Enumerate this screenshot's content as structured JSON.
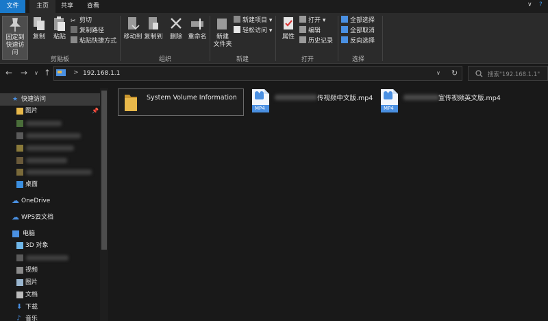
{
  "tabs": {
    "file": "文件",
    "home": "主页",
    "share": "共享",
    "view": "查看"
  },
  "window_controls": {
    "expand": "∨",
    "help": "?"
  },
  "ribbon": {
    "pin_label_line1": "固定到",
    "pin_label_line2": "快速访问",
    "copy": "复制",
    "paste": "粘贴",
    "cut": "剪切",
    "copy_path": "复制路径",
    "paste_shortcut": "粘贴快捷方式",
    "clipboard_group": "剪贴板",
    "move_to": "移动到",
    "copy_to": "复制到",
    "delete": "删除",
    "rename": "重命名",
    "organize_group": "组织",
    "new_folder_line1": "新建",
    "new_folder_line2": "文件夹",
    "new_item": "新建项目",
    "easy_access": "轻松访问",
    "new_group": "新建",
    "properties": "属性",
    "open": "打开",
    "edit": "编辑",
    "history": "历史记录",
    "open_group": "打开",
    "select_all": "全部选择",
    "select_none": "全部取消",
    "invert_selection": "反向选择",
    "select_group": "选择"
  },
  "address": {
    "path": "192.168.1.1",
    "separator": ">"
  },
  "search": {
    "placeholder": "搜索\"192.168.1.1\""
  },
  "nav": {
    "quick_access": "快速访问",
    "pictures_pinned": "图片",
    "desktop": "桌面",
    "onedrive": "OneDrive",
    "wps": "WPS云文档",
    "this_pc": "电脑",
    "objects3d": "3D 对象",
    "videos": "视频",
    "pictures": "图片",
    "documents": "文档",
    "downloads": "下载",
    "music": "音乐"
  },
  "files": [
    {
      "name": "System Volume Information",
      "type": "folder"
    },
    {
      "name_visible": "传视频中文版.mp4",
      "type": "mp4",
      "badge": "MP4"
    },
    {
      "name_visible": "宣传视频英文版.mp4",
      "type": "mp4",
      "badge": "MP4"
    }
  ],
  "colors": {
    "accent": "#1979ca",
    "folder": "#e8b84a",
    "mp4": "#4a90e2"
  }
}
